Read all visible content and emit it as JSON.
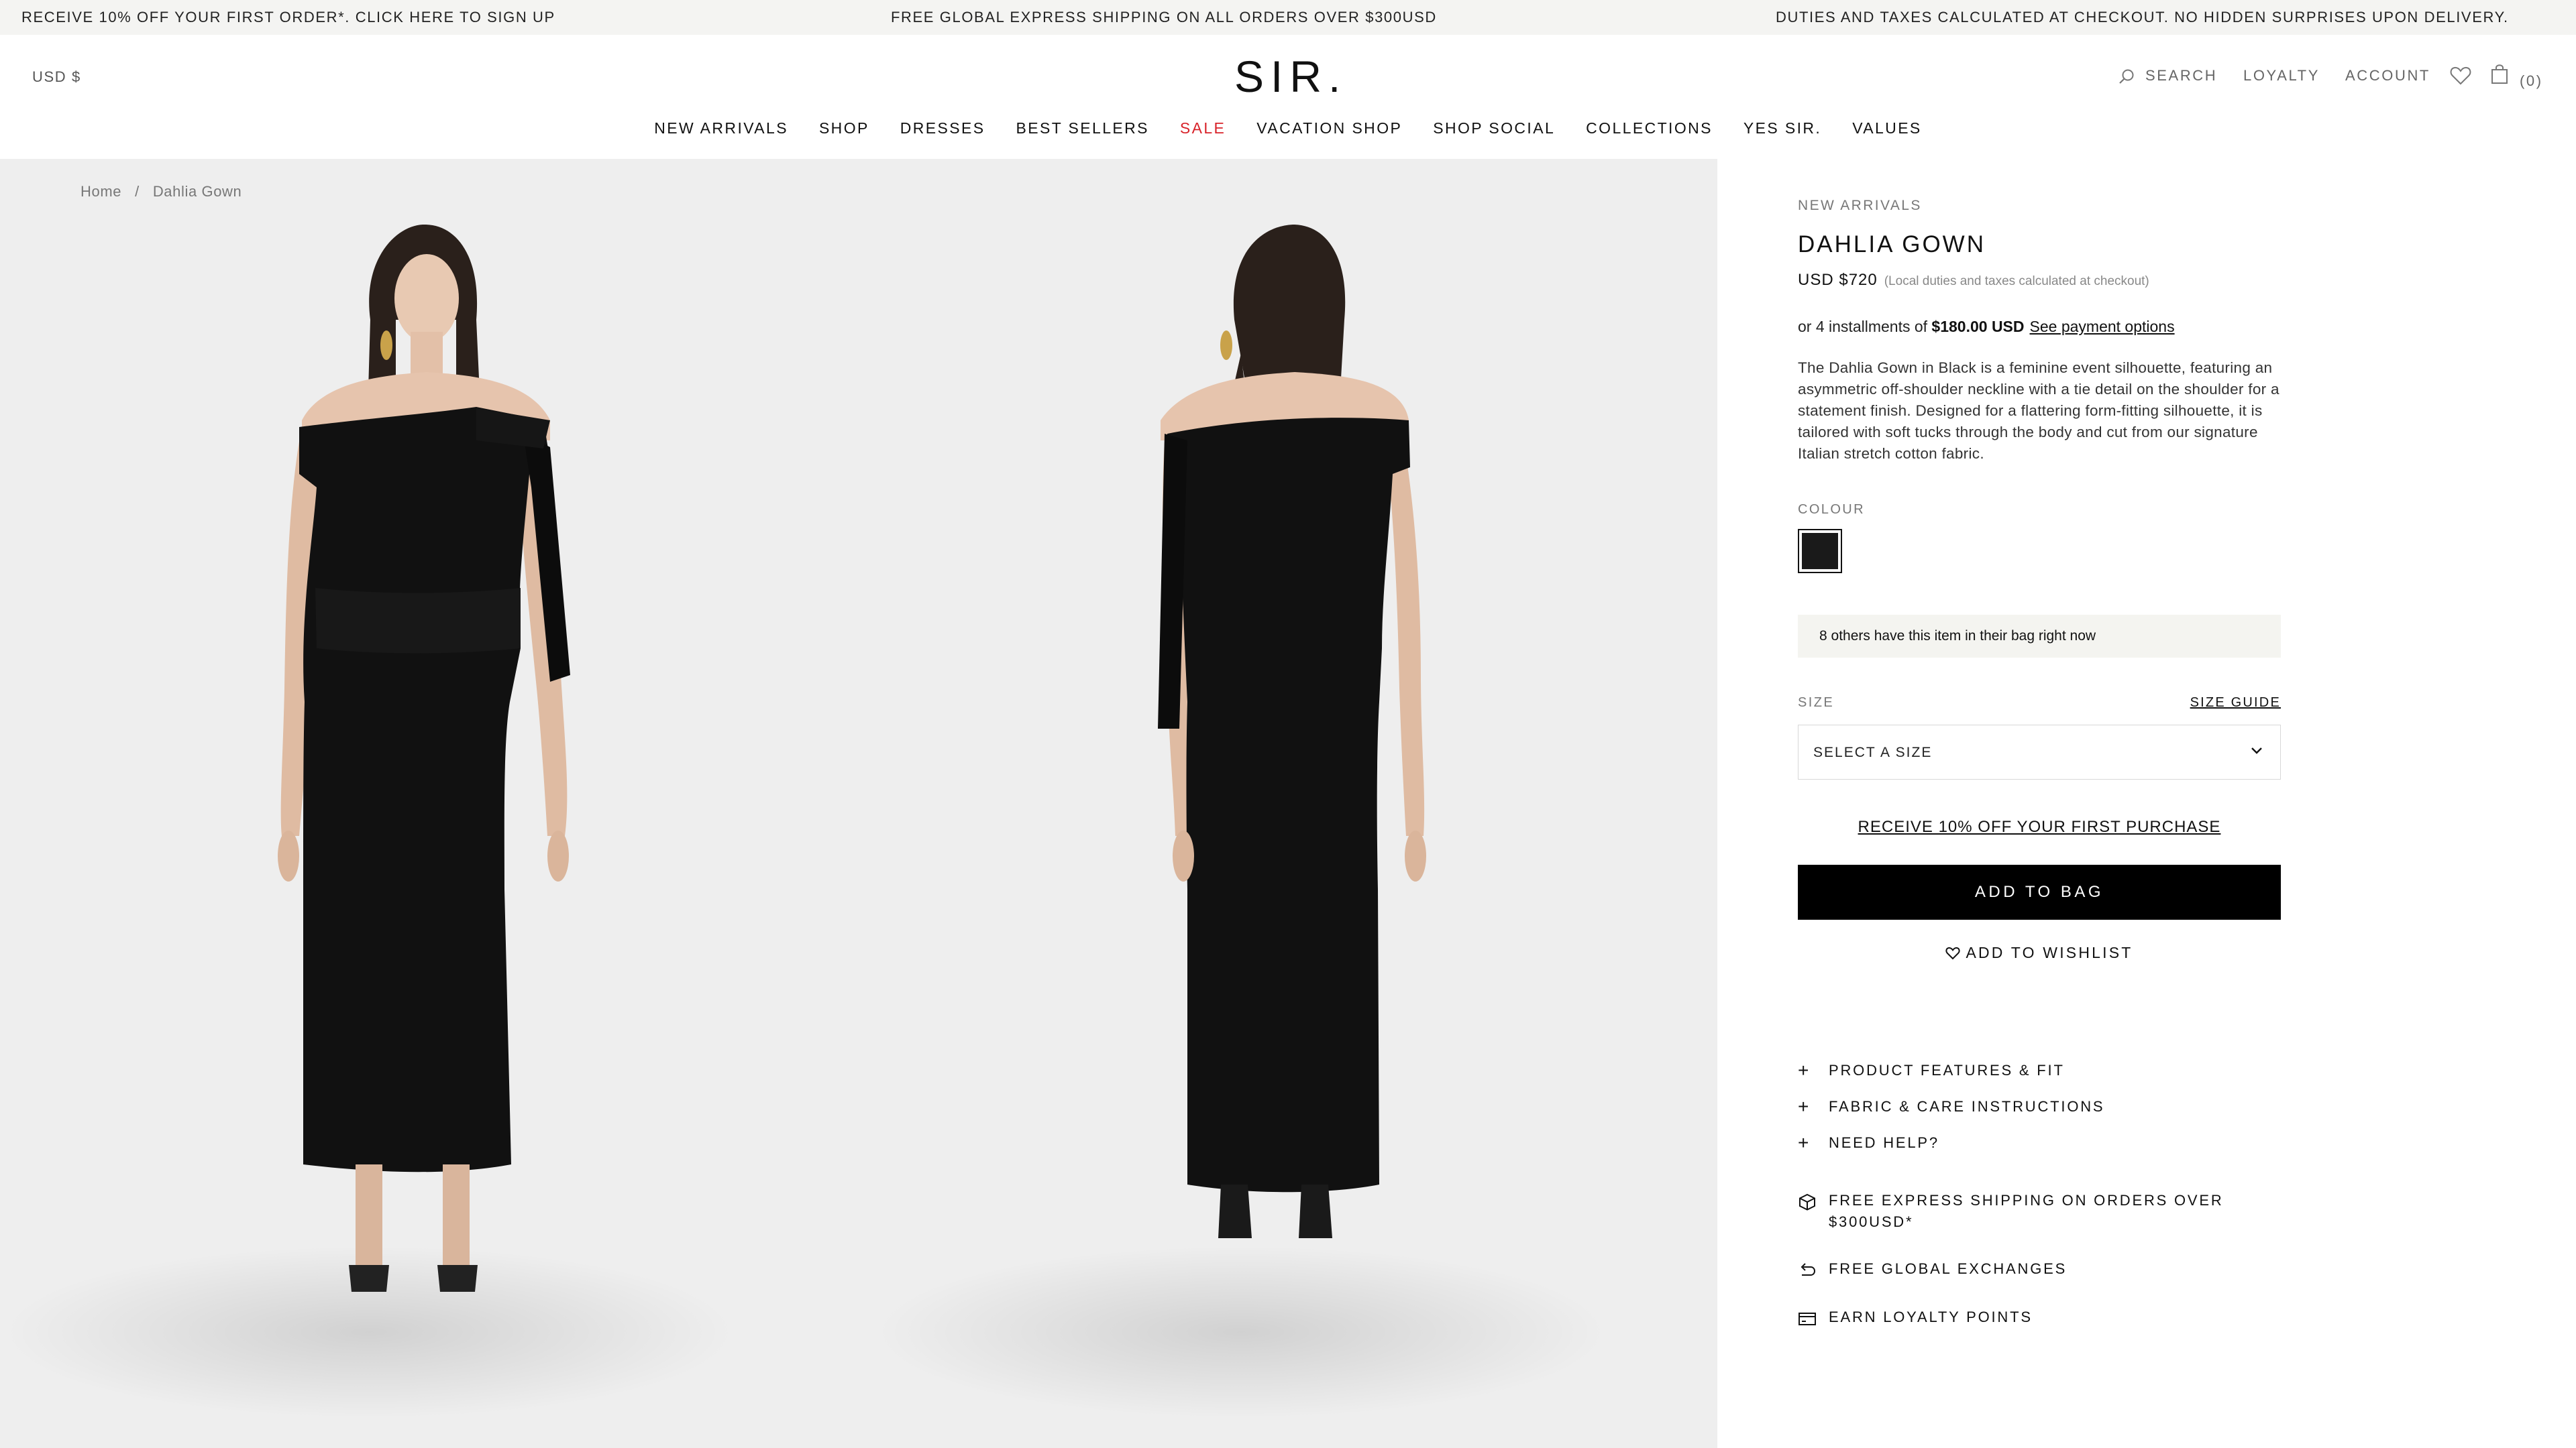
{
  "announcement": {
    "left": "RECEIVE 10% OFF YOUR FIRST ORDER*. CLICK HERE TO SIGN UP",
    "center": "FREE GLOBAL EXPRESS SHIPPING ON ALL ORDERS OVER $300USD",
    "right": "DUTIES AND TAXES CALCULATED AT CHECKOUT. NO HIDDEN SURPRISES UPON DELIVERY."
  },
  "header": {
    "currency": "USD $",
    "logo": "SIR.",
    "search_label": "SEARCH",
    "loyalty_label": "LOYALTY",
    "account_label": "ACCOUNT",
    "bag_count": "(0)"
  },
  "nav": [
    "NEW ARRIVALS",
    "SHOP",
    "DRESSES",
    "BEST SELLERS",
    "SALE",
    "VACATION SHOP",
    "SHOP SOCIAL",
    "COLLECTIONS",
    "YES SIR.",
    "VALUES"
  ],
  "breadcrumb": {
    "home": "Home",
    "separator": "/",
    "current": "Dahlia Gown"
  },
  "product": {
    "eyebrow": "NEW ARRIVALS",
    "title": "DAHLIA GOWN",
    "price": "USD $720",
    "price_note": "(Local duties and taxes calculated at checkout)",
    "installments_prefix": "or 4 installments of",
    "installments_amount": "$180.00 USD",
    "installments_link": "See payment options",
    "description": "The Dahlia Gown in Black is a feminine event silhouette, featuring an asymmetric off-shoulder neckline with a tie detail on the shoulder for a statement finish. Designed for a flattering form-fitting silhouette, it is tailored with soft tucks through the body and cut from our signature Italian stretch cotton fabric.",
    "colour_label": "COLOUR",
    "swatch_color": "#1a1a1a",
    "bag_notice": "8 others have this item in their bag right now",
    "size_label": "SIZE",
    "size_guide": "SIZE GUIDE",
    "size_select_placeholder": "SELECT A SIZE",
    "promo_link": "RECEIVE 10% OFF YOUR FIRST PURCHASE",
    "add_to_bag": "ADD TO BAG",
    "add_to_wishlist": "ADD TO WISHLIST",
    "accordions": [
      "PRODUCT FEATURES & FIT",
      "FABRIC & CARE INSTRUCTIONS",
      "NEED HELP?"
    ],
    "perks": [
      {
        "icon": "box-icon",
        "text": "FREE EXPRESS SHIPPING ON ORDERS OVER $300USD*"
      },
      {
        "icon": "return-arrow-icon",
        "text": "FREE GLOBAL EXCHANGES"
      },
      {
        "icon": "card-icon",
        "text": "EARN LOYALTY POINTS"
      }
    ]
  },
  "colors": {
    "sale": "#d8232a",
    "announce_bg": "#f4f4f2",
    "gallery_bg": "#eeeeee",
    "notice_bg": "#f4f4f0"
  }
}
